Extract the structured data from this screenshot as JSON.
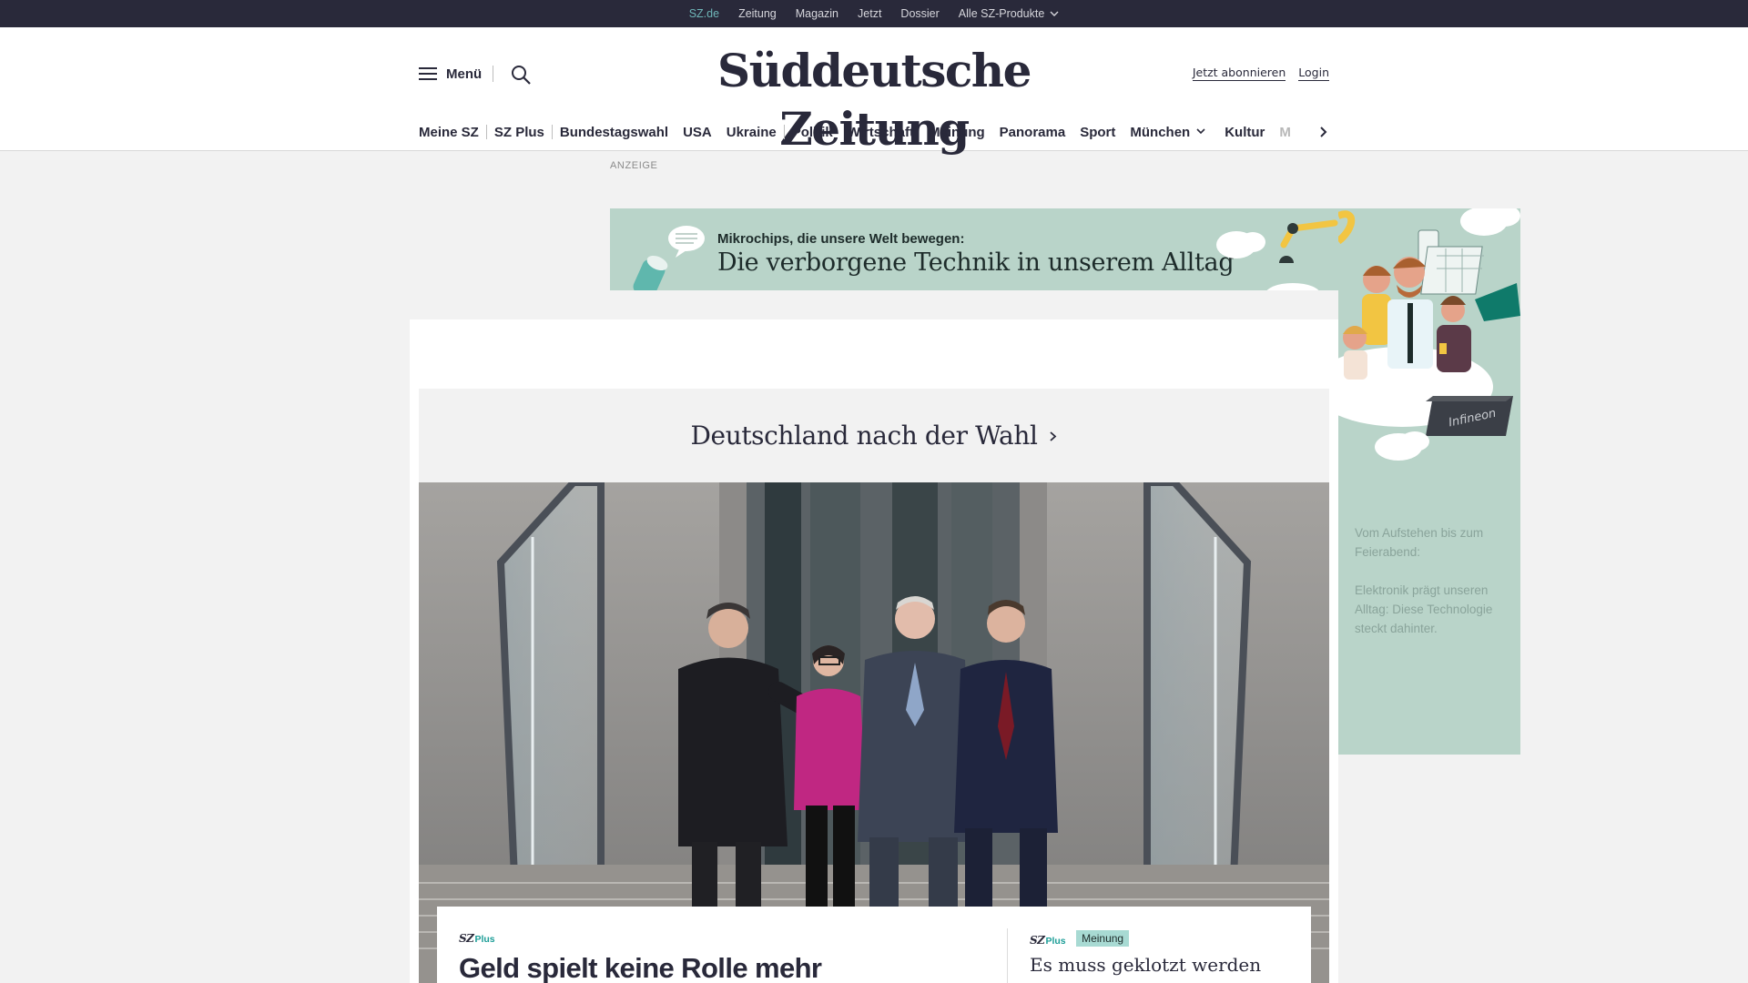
{
  "topbar": {
    "items": [
      {
        "label": "SZ.de"
      },
      {
        "label": "Zeitung"
      },
      {
        "label": "Magazin"
      },
      {
        "label": "Jetzt"
      },
      {
        "label": "Dossier"
      },
      {
        "label": "Alle SZ-Produkte"
      }
    ],
    "active_index": 0,
    "active_color": "#6fb6b8"
  },
  "header": {
    "menu_label": "Menü",
    "logo": "Süddeutsche Zeitung",
    "subscribe_label": "Jetzt abonnieren",
    "login_label": "Login",
    "icons": {
      "menu": "hamburger-icon",
      "search": "search-icon"
    }
  },
  "nav": {
    "items": [
      {
        "label": "Meine SZ"
      },
      {
        "label": "SZ Plus"
      },
      {
        "label": "Bundestagswahl"
      },
      {
        "label": "USA"
      },
      {
        "label": "Ukraine"
      },
      {
        "label": "Politik"
      },
      {
        "label": "Wirtschaft"
      },
      {
        "label": "Meinung"
      },
      {
        "label": "Panorama"
      },
      {
        "label": "Sport"
      },
      {
        "label": "München"
      },
      {
        "label": "Kultur"
      },
      {
        "label": "M"
      }
    ],
    "next_icon": "chevron-right-icon"
  },
  "ad": {
    "label": "ANZEIGE",
    "kicker": "Mikrochips, die unsere Welt bewegen:",
    "title": "Die verborgene Technik in unserem Alltag",
    "brand": "Infineon",
    "side_text_1": "Vom Aufstehen bis zum Feierabend:",
    "side_text_2": "Elektronik prägt unseren Alltag: Diese Technologie steckt dahinter.",
    "background_color": "#b9d4c9"
  },
  "main": {
    "dossier_title": "Deutschland nach der Wahl",
    "hero_alt": "hero-photo",
    "teaser_lead": {
      "sz_mark": "SZ",
      "plus_mark": "Plus",
      "headline": "Geld spielt keine Rolle mehr"
    },
    "teaser_side": {
      "sz_mark": "SZ",
      "plus_mark": "Plus",
      "badge": "Meinung",
      "headline": "Es muss geklotzt werden"
    },
    "accent_color": "#1e9e98"
  }
}
